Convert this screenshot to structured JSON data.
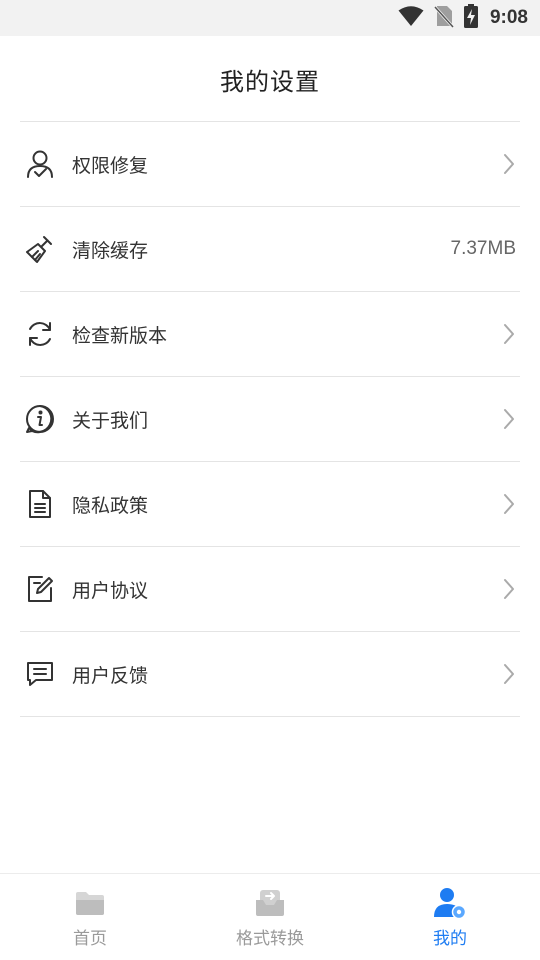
{
  "status_bar": {
    "time": "9:08",
    "icons": [
      "wifi-icon",
      "no-sim-icon",
      "battery-charging-icon"
    ]
  },
  "header": {
    "title": "我的设置"
  },
  "settings": {
    "items": [
      {
        "label": "权限修复",
        "icon": "user-check-icon",
        "trailing": "chevron"
      },
      {
        "label": "清除缓存",
        "icon": "broom-icon",
        "trailing": "value",
        "value": "7.37MB"
      },
      {
        "label": "检查新版本",
        "icon": "refresh-icon",
        "trailing": "chevron"
      },
      {
        "label": "关于我们",
        "icon": "info-icon",
        "trailing": "chevron"
      },
      {
        "label": "隐私政策",
        "icon": "document-icon",
        "trailing": "chevron"
      },
      {
        "label": "用户协议",
        "icon": "edit-note-icon",
        "trailing": "chevron"
      },
      {
        "label": "用户反馈",
        "icon": "message-icon",
        "trailing": "chevron"
      }
    ]
  },
  "bottom_nav": {
    "tabs": [
      {
        "label": "首页",
        "icon": "folder-icon",
        "active": false
      },
      {
        "label": "格式转换",
        "icon": "convert-icon",
        "active": false
      },
      {
        "label": "我的",
        "icon": "user-settings-icon",
        "active": true
      }
    ]
  },
  "colors": {
    "accent": "#1e7cf2",
    "inactive": "#9a9a9a",
    "divider": "#e4e4e4",
    "text": "#333333",
    "status_bar_bg": "#f2f2f2"
  }
}
